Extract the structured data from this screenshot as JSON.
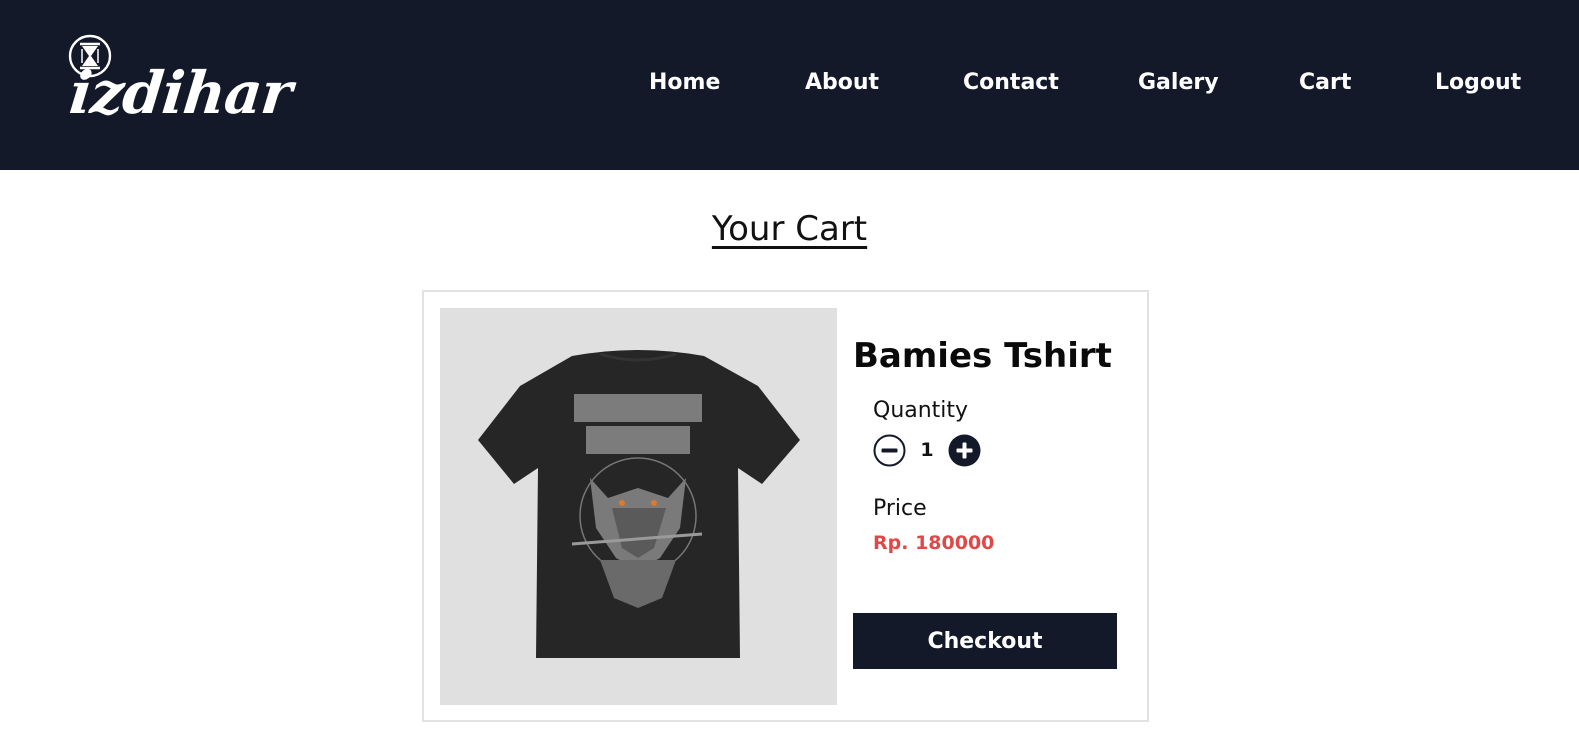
{
  "header": {
    "logo_text": "izdihar",
    "nav": [
      {
        "label": "Home"
      },
      {
        "label": "About"
      },
      {
        "label": "Contact"
      },
      {
        "label": "Galery"
      },
      {
        "label": "Cart"
      },
      {
        "label": "Logout"
      }
    ]
  },
  "page": {
    "title": "Your Cart"
  },
  "cart_item": {
    "name": "Bamies Tshirt",
    "image_icon": "tshirt-image",
    "quantity_label": "Quantity",
    "quantity": "1",
    "minus_icon": "minus-circle-icon",
    "plus_icon": "plus-circle-icon",
    "price_label": "Price",
    "price": "Rp. 180000",
    "checkout_label": "Checkout"
  },
  "colors": {
    "navbar": "#131929",
    "price": "#e04848",
    "button": "#131929",
    "image_bg": "#e0e0e0"
  }
}
